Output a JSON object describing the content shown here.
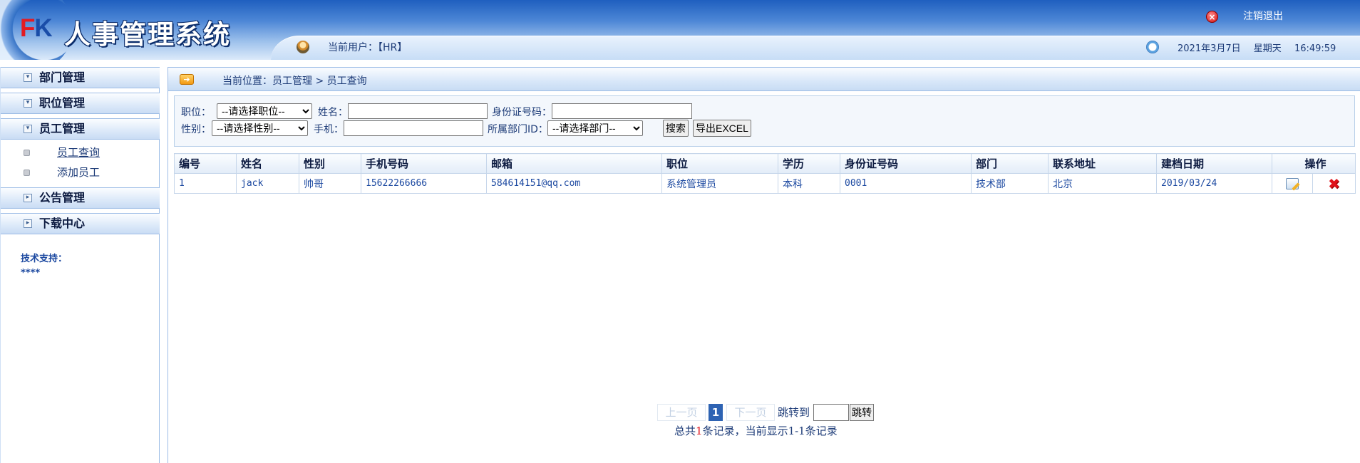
{
  "header": {
    "logo_f": "F",
    "logo_k": "K",
    "system_title": "人事管理系统",
    "logout_label": "注销退出",
    "current_user": "当前用户：【HR】",
    "date": "2021年3月7日",
    "weekday": "星期天",
    "time": "16:49:59"
  },
  "sidebar": {
    "menus": [
      {
        "label": "部门管理",
        "toggle": "▾"
      },
      {
        "label": "职位管理",
        "toggle": "▾"
      },
      {
        "label": "员工管理",
        "toggle": "▾"
      },
      {
        "label": "公告管理",
        "toggle": "▸"
      },
      {
        "label": "下载中心",
        "toggle": "▸"
      }
    ],
    "employee_submenu": [
      {
        "label": "员工查询",
        "active": true
      },
      {
        "label": "添加员工",
        "active": false
      }
    ],
    "support_label": "技术支持：",
    "support_value": "****"
  },
  "location": {
    "text": "当前位置：员工管理 > 员工查询"
  },
  "search": {
    "position_label": "职位：",
    "position_selected": "--请选择职位--",
    "name_label": "姓名：",
    "name_value": "",
    "idcard_label": "身份证号码：",
    "idcard_value": "",
    "gender_label": "性别：",
    "gender_selected": "--请选择性别--",
    "phone_label": "手机：",
    "phone_value": "",
    "dept_label": "所属部门ID：",
    "dept_selected": "--请选择部门--",
    "search_button": "搜索",
    "export_button": "导出EXCEL"
  },
  "table": {
    "headers": [
      "编号",
      "姓名",
      "性别",
      "手机号码",
      "邮箱",
      "职位",
      "学历",
      "身份证号码",
      "部门",
      "联系地址",
      "建档日期",
      "操作"
    ],
    "rows": [
      {
        "id": "1",
        "name": "jack",
        "gender": "帅哥",
        "phone": "15622266666",
        "email": "584614151@qq.com",
        "position": "系统管理员",
        "education": "本科",
        "idcard": "0001",
        "department": "技术部",
        "address": "北京",
        "created": "2019/03/24"
      }
    ]
  },
  "pager": {
    "prev_label": "上一页",
    "current_page": "1",
    "next_label": "下一页",
    "jump_label": "跳转到",
    "jump_value": "",
    "jump_button": "跳转",
    "summary_prefix": "总共",
    "total": "1",
    "summary_suffix": "条记录，当前显示1-1条记录"
  },
  "colors": {
    "header_dark": "#1f5fbf",
    "link_blue": "#1b48a0",
    "current_page_bg": "#2e63b3",
    "alert_red": "#e0121a"
  },
  "icons": {
    "logout": "close-circle-icon",
    "user": "user-icon",
    "clock": "clock-icon",
    "location": "arrow-right-icon",
    "edit": "edit-icon",
    "delete": "delete-x-icon"
  }
}
